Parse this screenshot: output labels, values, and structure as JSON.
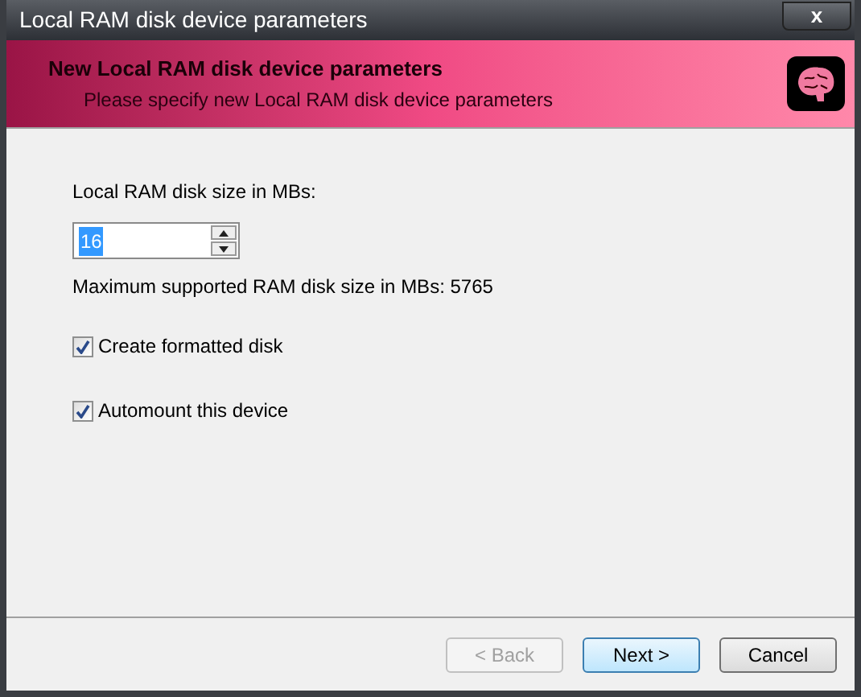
{
  "window": {
    "title": "Local RAM disk device parameters",
    "close": "x"
  },
  "header": {
    "title": "New Local RAM disk device parameters",
    "subtitle": "Please specify new Local RAM disk device parameters"
  },
  "size_field": {
    "label": "Local RAM disk size in MBs:",
    "value": "16",
    "highlighted": true
  },
  "max_note": "Maximum supported RAM disk size in MBs: 5765",
  "options": [
    {
      "label": "Create formatted disk",
      "checked": true
    },
    {
      "label": "Automount this device",
      "checked": true
    }
  ],
  "buttons": [
    {
      "label": "< Back",
      "disabled": true,
      "default": false
    },
    {
      "label": "Next >",
      "disabled": false,
      "default": true
    },
    {
      "label": "Cancel",
      "disabled": false,
      "default": false
    }
  ]
}
